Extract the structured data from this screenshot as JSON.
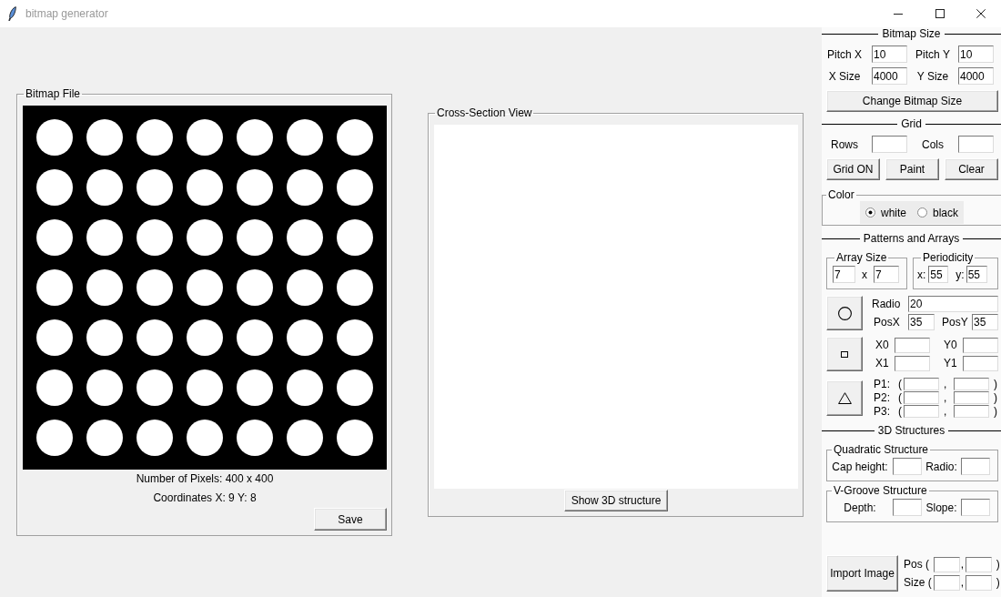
{
  "window": {
    "title": "bitmap generator"
  },
  "bitmap_file": {
    "title": "Bitmap File",
    "pixel_count": "Number of Pixels: 400 x 400",
    "coordinates": "Coordinates X: 9 Y: 8",
    "save_button": "Save"
  },
  "cross_section_view": {
    "title": "Cross-Section View",
    "button": "Show 3D structure"
  },
  "bitmap_size": {
    "title": "Bitmap Size",
    "fields": [
      {
        "label": "Pitch X",
        "value": "10"
      },
      {
        "label": "Pitch Y",
        "value": "10"
      },
      {
        "label": "X Size",
        "value": "4000"
      },
      {
        "label": "Y Size",
        "value": "4000"
      }
    ],
    "button": "Change Bitmap Size"
  },
  "grid": {
    "title": "Grid",
    "fields": [
      {
        "label": "Rows"
      },
      {
        "label": "Cols"
      }
    ],
    "buttons": [
      "Grid ON",
      "Paint",
      "Clear"
    ]
  },
  "color": {
    "title": "Color",
    "options": [
      {
        "label": "white",
        "selected": true
      },
      {
        "label": "black",
        "selected": false
      }
    ]
  },
  "patterns_and_arrays": {
    "title": "Patterns and Arrays",
    "array_size": {
      "title": "Array Size",
      "x_value": "7",
      "separator": "x",
      "y_value": "7"
    },
    "periodicity": {
      "title": "Periodicity",
      "fields": [
        {
          "label": "x:",
          "value": "55"
        },
        {
          "label": "y:",
          "value": "55"
        }
      ]
    },
    "shapes": [
      {
        "kind": "circle",
        "fields": [
          {
            "label": "Radio",
            "value": "20"
          },
          {
            "label": "PosX",
            "value": "35"
          },
          {
            "label": "PosY",
            "value": "35"
          }
        ]
      },
      {
        "kind": "square",
        "fields": [
          {
            "label": "X0"
          },
          {
            "label": "Y0"
          },
          {
            "label": "X1"
          },
          {
            "label": "Y1"
          }
        ]
      },
      {
        "kind": "triangle",
        "points": [
          {
            "label": "P1:",
            "open": "(",
            "comma": ",",
            "close": ")"
          },
          {
            "label": "P2:",
            "open": "(",
            "comma": ",",
            "close": ")"
          },
          {
            "label": "P3:",
            "open": "(",
            "comma": ",",
            "close": ")"
          }
        ]
      }
    ]
  },
  "structures_3d": {
    "title": "3D Structures",
    "groups": [
      {
        "title": "Quadratic Structure",
        "fields": [
          {
            "label": "Cap height:"
          },
          {
            "label": "Radio:"
          }
        ]
      },
      {
        "title": "V-Groove Structure",
        "fields": [
          {
            "label": "Depth:"
          },
          {
            "label": "Slope:"
          }
        ]
      }
    ]
  },
  "import_image": {
    "button": "Import Image",
    "rows": [
      {
        "label": "Pos (",
        "comma": ",",
        "close": ")"
      },
      {
        "label": "Size (",
        "comma": ",",
        "close": ")"
      }
    ]
  }
}
